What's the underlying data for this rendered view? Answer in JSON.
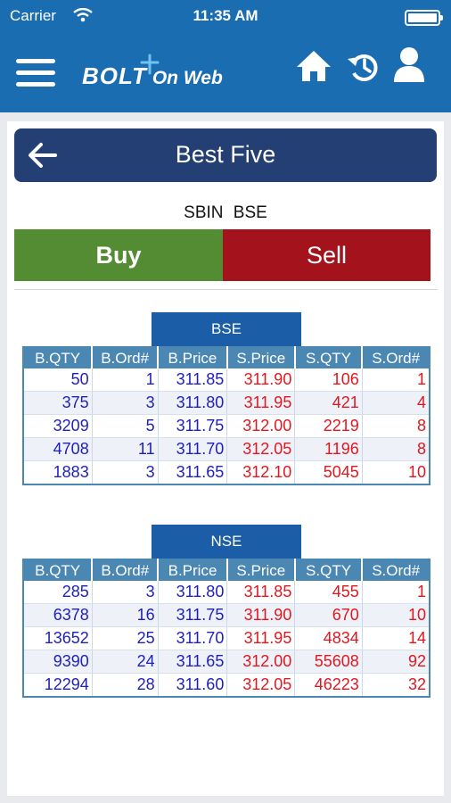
{
  "status_bar": {
    "carrier": "Carrier",
    "time": "11:35 AM"
  },
  "app": {
    "logo_main": "BOLT",
    "logo_sub": "On Web"
  },
  "nav_icons": [
    "menu-icon",
    "home-icon",
    "history-icon",
    "user-icon"
  ],
  "header": {
    "title": "Best Five"
  },
  "symbol": {
    "name": "SBIN",
    "exchange": "BSE"
  },
  "actions": {
    "buy": "Buy",
    "sell": "Sell"
  },
  "colors": {
    "brand": "#1b6db2",
    "header": "#243f73",
    "buy": "#548c33",
    "sell": "#a4131b",
    "bid_text": "#1d1fbe",
    "ask_text": "#e1171f"
  },
  "columns": [
    "B.QTY",
    "B.Ord#",
    "B.Price",
    "S.Price",
    "S.QTY",
    "S.Ord#"
  ],
  "tables": [
    {
      "label": "BSE",
      "rows": [
        [
          "50",
          "1",
          "311.85",
          "311.90",
          "106",
          "1"
        ],
        [
          "375",
          "3",
          "311.80",
          "311.95",
          "421",
          "4"
        ],
        [
          "3209",
          "5",
          "311.75",
          "312.00",
          "2219",
          "8"
        ],
        [
          "4708",
          "11",
          "311.70",
          "312.05",
          "1196",
          "8"
        ],
        [
          "1883",
          "3",
          "311.65",
          "312.10",
          "5045",
          "10"
        ]
      ]
    },
    {
      "label": "NSE",
      "rows": [
        [
          "285",
          "3",
          "311.80",
          "311.85",
          "455",
          "1"
        ],
        [
          "6378",
          "16",
          "311.75",
          "311.90",
          "670",
          "10"
        ],
        [
          "13652",
          "25",
          "311.70",
          "311.95",
          "4834",
          "14"
        ],
        [
          "9390",
          "24",
          "311.65",
          "312.00",
          "55608",
          "92"
        ],
        [
          "12294",
          "28",
          "311.60",
          "312.05",
          "46223",
          "32"
        ]
      ]
    }
  ]
}
